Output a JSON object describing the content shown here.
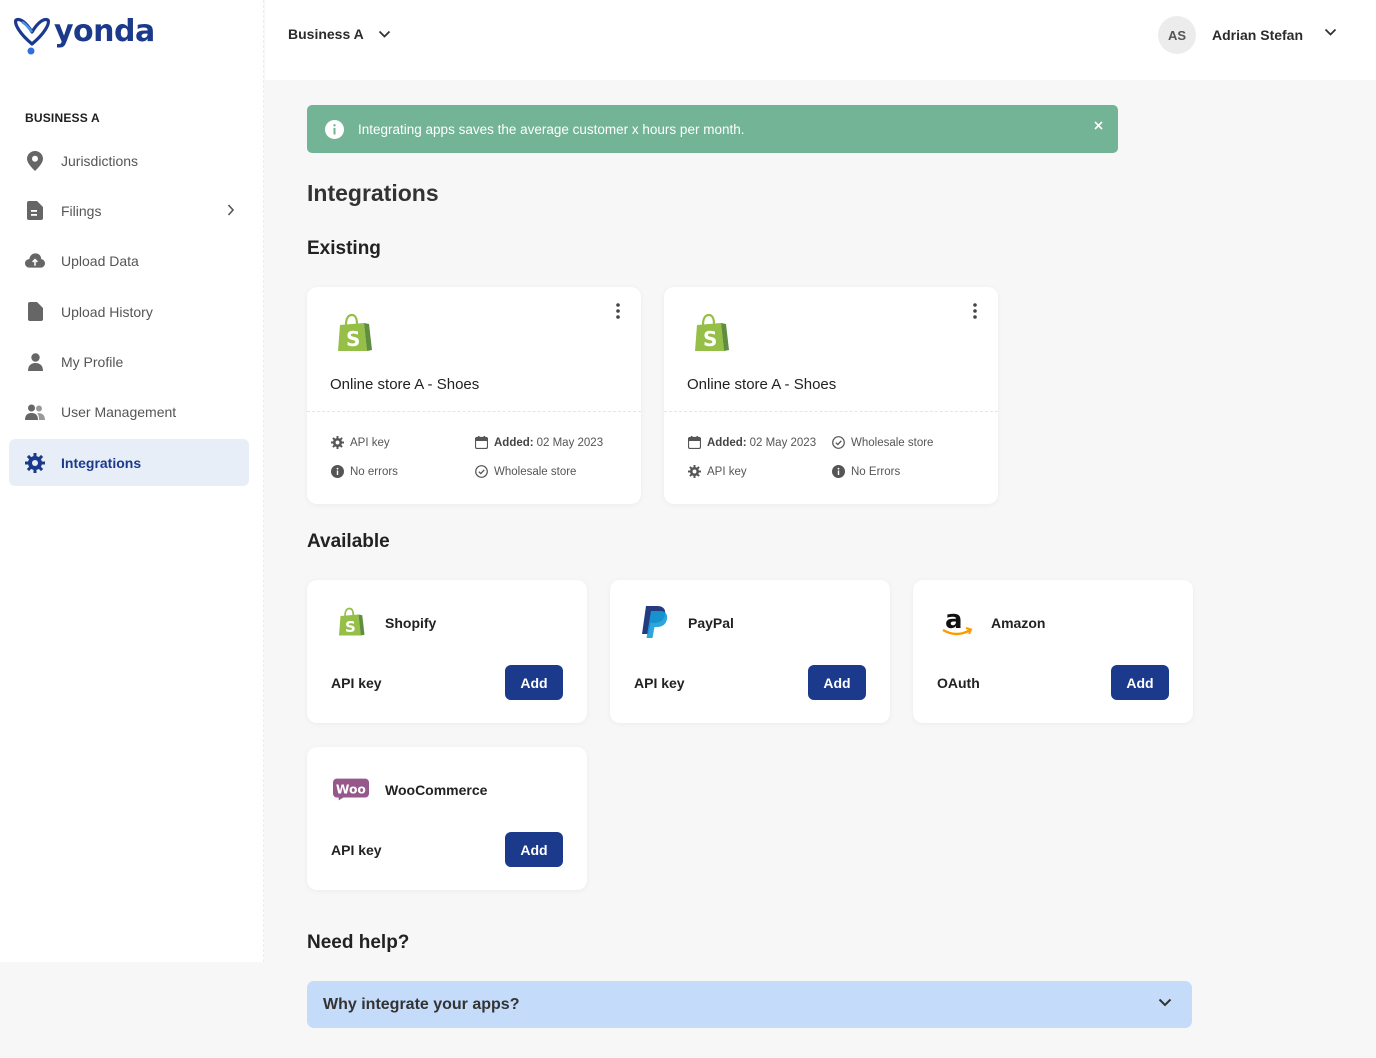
{
  "brand": {
    "name": "yonda",
    "color": "#1b3a8c",
    "accent": "#4a90e2"
  },
  "sidebar": {
    "business_label": "BUSINESS A",
    "items": [
      {
        "label": "Jurisdictions",
        "icon": "map-pin-icon"
      },
      {
        "label": "Filings",
        "icon": "document-icon"
      },
      {
        "label": "Upload Data",
        "icon": "cloud-upload-icon"
      },
      {
        "label": "Upload History",
        "icon": "file-icon"
      },
      {
        "label": "My Profile",
        "icon": "user-icon"
      },
      {
        "label": "User Management",
        "icon": "users-icon"
      },
      {
        "label": "Integrations",
        "icon": "gear-icon",
        "active": true
      }
    ]
  },
  "header": {
    "business_select": "Business A",
    "avatar_initials": "AS",
    "user_name": "Adrian Stefan"
  },
  "alert": {
    "text": "Integrating apps saves the average customer x hours per month.",
    "color": "#73b396"
  },
  "page": {
    "title": "Integrations",
    "existing_heading": "Existing",
    "available_heading": "Available",
    "help_heading": "Need help?"
  },
  "existing": [
    {
      "name": "Online store A - Shoes",
      "platform_icon": "shopify-icon",
      "api_key": "API key",
      "added_label": "Added:",
      "added_date": "02 May 2023",
      "errors": "No errors",
      "store_type": "Wholesale store"
    },
    {
      "name": "Online store A - Shoes",
      "platform_icon": "shopify-icon",
      "added_label": "Added:",
      "added_date": "02 May 2023",
      "store_type": "Wholesale store",
      "api_key": "API key",
      "errors": "No Errors"
    }
  ],
  "available": [
    {
      "name": "Shopify",
      "auth": "API key",
      "button": "Add",
      "icon": "shopify-icon"
    },
    {
      "name": "PayPal",
      "auth": "API key",
      "button": "Add",
      "icon": "paypal-icon"
    },
    {
      "name": "Amazon",
      "auth": "OAuth",
      "button": "Add",
      "icon": "amazon-icon"
    },
    {
      "name": "WooCommerce",
      "auth": "API key",
      "button": "Add",
      "icon": "woocommerce-icon"
    }
  ],
  "help": {
    "question": "Why integrate your apps?",
    "color": "#c4dbfa"
  }
}
